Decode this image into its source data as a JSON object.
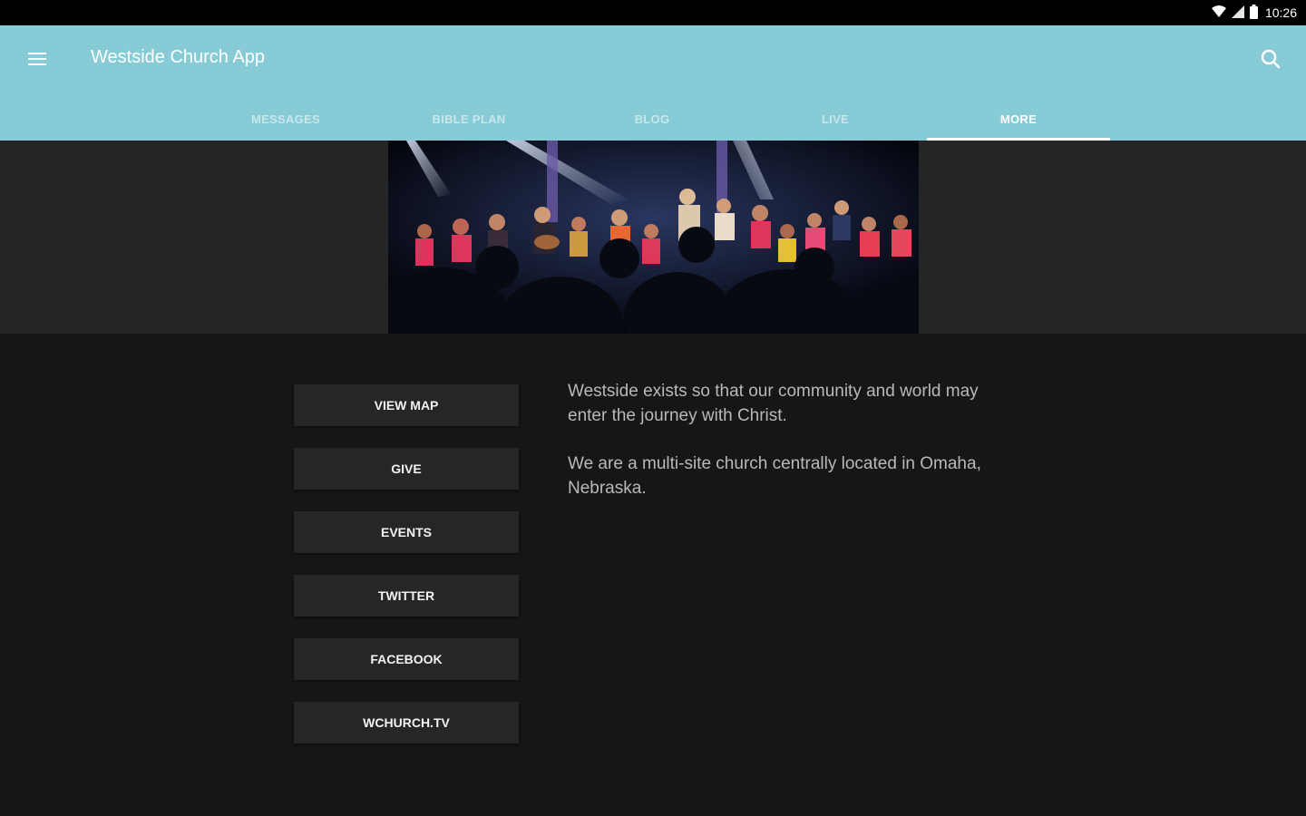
{
  "status_bar": {
    "time": "10:26",
    "icons": [
      "wifi-icon",
      "signal-icon",
      "battery-icon"
    ]
  },
  "app_bar": {
    "title": "Westside Church App",
    "menu_icon": "hamburger-menu-icon",
    "search_icon": "search-icon",
    "background_color": "#86cbd5"
  },
  "tabs": [
    {
      "label": "MESSAGES",
      "active": false
    },
    {
      "label": "BIBLE PLAN",
      "active": false
    },
    {
      "label": "BLOG",
      "active": false
    },
    {
      "label": "LIVE",
      "active": false
    },
    {
      "label": "MORE",
      "active": true
    }
  ],
  "buttons": [
    {
      "label": "VIEW MAP"
    },
    {
      "label": "GIVE"
    },
    {
      "label": "EVENTS"
    },
    {
      "label": "TWITTER"
    },
    {
      "label": "FACEBOOK"
    },
    {
      "label": "WCHURCH.TV"
    }
  ],
  "about": {
    "paragraphs": [
      "Westside exists so that our community and world may enter the journey with Christ.",
      "We are a multi-site church centrally located in Omaha, Nebraska."
    ]
  }
}
